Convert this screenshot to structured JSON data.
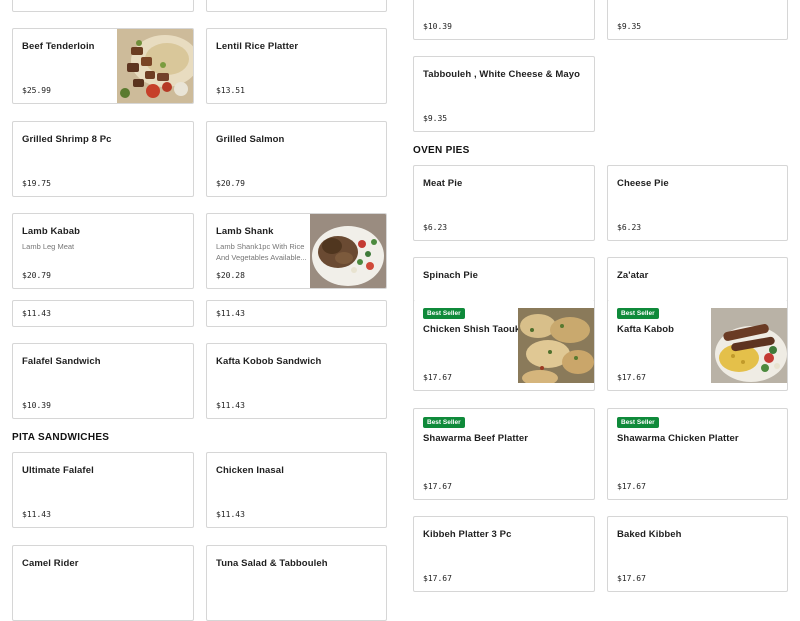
{
  "sections": {
    "pita_sandwiches": "PITA SANDWICHES",
    "oven_pies": "OVEN PIES"
  },
  "best_seller_label": "Best Seller",
  "left_items": [
    {
      "name": "",
      "price": ""
    },
    {
      "name": "",
      "price": ""
    },
    {
      "name": "Beef Tenderloin",
      "price": "$25.99"
    },
    {
      "name": "Lentil Rice Platter",
      "price": "$13.51"
    },
    {
      "name": "Grilled Shrimp 8 Pc",
      "price": "$19.75"
    },
    {
      "name": "Grilled Salmon",
      "price": "$20.79"
    },
    {
      "name": "Lamb Kabab",
      "description": "Lamb Leg Meat",
      "price": "$20.79"
    },
    {
      "name": "Lamb Shank",
      "description": "Lamb Shank1pc With Rice And Vegetables Available...",
      "price": "$20.28"
    },
    {
      "name": "",
      "price": "$11.43"
    },
    {
      "name": "",
      "price": "$11.43"
    },
    {
      "name": "Falafel Sandwich",
      "price": "$10.39"
    },
    {
      "name": "Kafta Kobob Sandwich",
      "price": "$11.43"
    },
    {
      "name": "Ultimate Falafel",
      "price": "$11.43"
    },
    {
      "name": "Chicken Inasal",
      "price": "$11.43"
    },
    {
      "name": "Camel Rider",
      "price": ""
    },
    {
      "name": "Tuna Salad & Tabbouleh",
      "price": ""
    }
  ],
  "right_items": [
    {
      "name": "",
      "price": "$10.39"
    },
    {
      "name": "",
      "price": "$9.35"
    },
    {
      "name": "Tabbouleh , White Cheese & Mayo",
      "price": "$9.35"
    },
    {
      "name": "Meat Pie",
      "price": "$6.23"
    },
    {
      "name": "Cheese Pie",
      "price": "$6.23"
    },
    {
      "name": "Spinach Pie",
      "price": ""
    },
    {
      "name": "Za'atar",
      "price": ""
    },
    {
      "name": "Chicken Shish Taouk",
      "price": "$17.67",
      "badge": "Best Seller"
    },
    {
      "name": "Kafta Kabob",
      "price": "$17.67",
      "badge": "Best Seller"
    },
    {
      "name": "Shawarma Beef Platter",
      "price": "$17.67",
      "badge": "Best Seller"
    },
    {
      "name": "Shawarma Chicken Platter",
      "price": "$17.67",
      "badge": "Best Seller"
    },
    {
      "name": "Kibbeh Platter 3 Pc",
      "price": "$17.67"
    },
    {
      "name": "Baked Kibbeh",
      "price": "$17.67"
    }
  ],
  "colors": {
    "badge": "#0f8a3a",
    "border": "#d6d6d6",
    "text": "#1f1f1f",
    "muted": "#767676"
  },
  "images": {
    "beef_tenderloin": "food-photo-beef-tenderloin",
    "lamb_shank": "food-photo-lamb-shank",
    "chicken_shish_taouk": "food-photo-chicken-shish-taouk",
    "kafta_kabob": "food-photo-kafta-kabob"
  }
}
